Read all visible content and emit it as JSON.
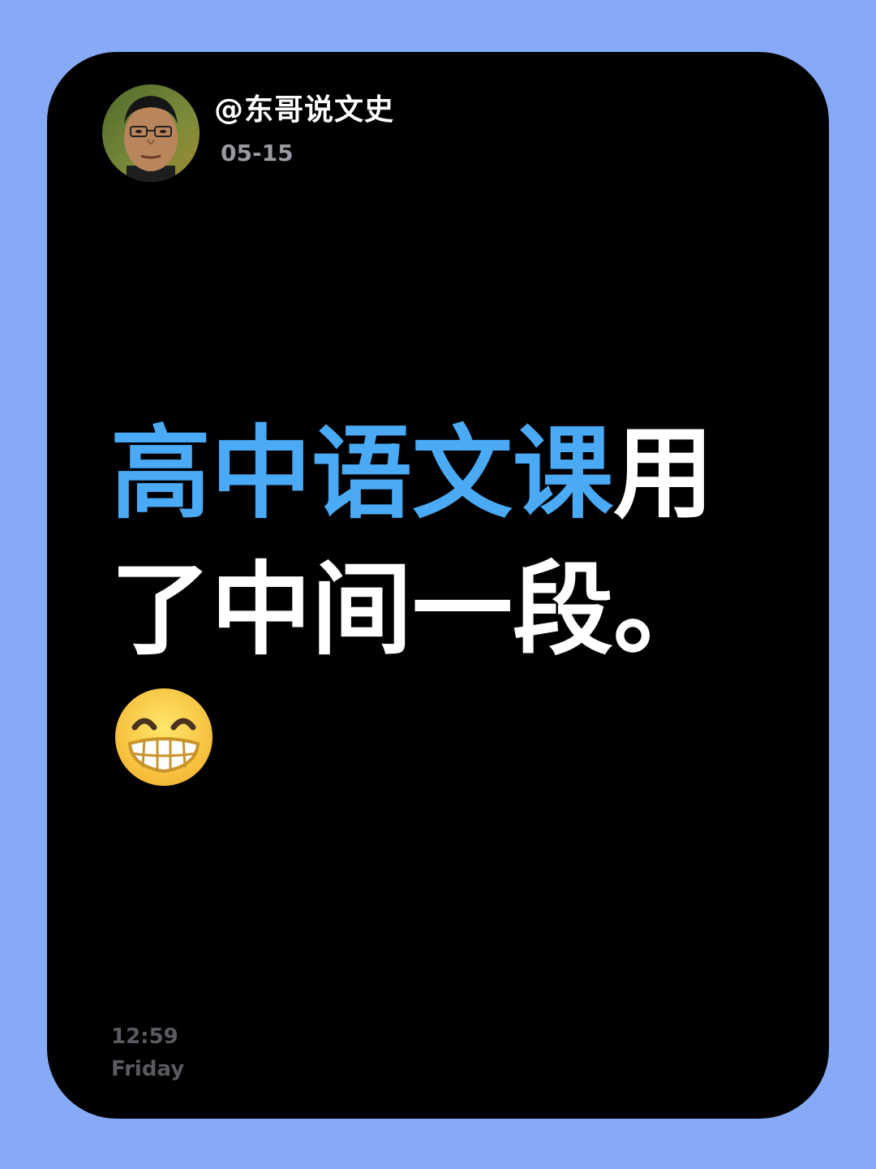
{
  "post": {
    "author": "@东哥说文史",
    "date": "05-15",
    "headline_highlight": "高中语文课",
    "headline_rest": "用了中间一段。",
    "emoji_icon": "grinning-face-with-smiling-eyes-icon",
    "time": "12:59",
    "weekday": "Friday"
  },
  "colors": {
    "background": "#87aaf7",
    "card": "#000000",
    "highlight": "#4aaaf5",
    "text": "#ffffff",
    "muted": "#5a5a60"
  }
}
